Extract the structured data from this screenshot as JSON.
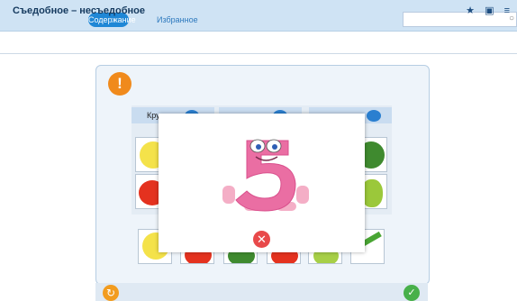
{
  "header": {
    "tab_active": "Содержание",
    "tab_inactive": "Избранное",
    "search_placeholder": ""
  },
  "title": "Съедобное – несъедобное",
  "grid": {
    "header_fragment": "Кру"
  },
  "icons": {
    "warning": "!",
    "bookmark": "★",
    "save": "save-icon",
    "menu": "menu-icon",
    "search": "search-icon",
    "reload": "reload-icon",
    "check": "check-icon",
    "close": "close-icon",
    "sound": "sound-icon"
  },
  "modal": {
    "character": "5"
  },
  "colors": {
    "accent": "#1f87d6",
    "warning": "#f08a1c",
    "success": "#48b04a",
    "close": "#e8494a"
  }
}
